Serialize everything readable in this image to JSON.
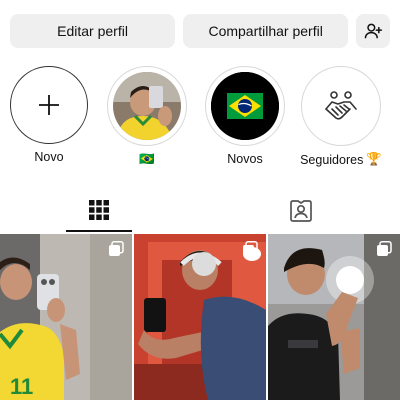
{
  "profile_actions": {
    "edit_label": "Editar perfil",
    "share_label": "Compartilhar perfil"
  },
  "highlights": [
    {
      "label": "Novo",
      "icon": "plus-icon"
    },
    {
      "label": "",
      "emoji": "🇧🇷",
      "icon": "brazil-flag-icon"
    },
    {
      "label": "Novos",
      "icon": "brazil-flag-icon"
    },
    {
      "label": "Seguidores",
      "emoji": "🏆",
      "icon": "handshake-icon"
    }
  ],
  "tabs": [
    {
      "name": "grid",
      "icon": "grid-icon",
      "active": true
    },
    {
      "name": "tagged",
      "icon": "tagged-person-icon",
      "active": false
    }
  ],
  "posts": [
    {
      "icon": "multiple-posts-icon"
    },
    {
      "icon": "multiple-posts-icon"
    },
    {
      "icon": "multiple-posts-icon"
    }
  ],
  "colors": {
    "button_bg": "#efefef",
    "flag_green": "#009c3b",
    "flag_yellow": "#ffdf00",
    "flag_blue": "#002776"
  }
}
